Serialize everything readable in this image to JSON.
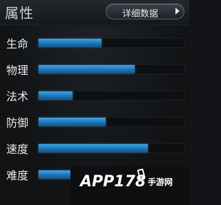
{
  "header": {
    "title": "属性",
    "detail_button_label": "详细数据"
  },
  "stats": [
    {
      "label": "生命",
      "value": 0.43
    },
    {
      "label": "物理",
      "value": 0.66
    },
    {
      "label": "法术",
      "value": 0.23
    },
    {
      "label": "防御",
      "value": 0.46
    },
    {
      "label": "速度",
      "value": 0.75
    },
    {
      "label": "难度",
      "value": 0.25
    }
  ],
  "watermark": {
    "brand": "APP178",
    "sub": "手游网"
  },
  "colors": {
    "bar_fill": "#2a8fd2",
    "track": "#0d0f11"
  }
}
